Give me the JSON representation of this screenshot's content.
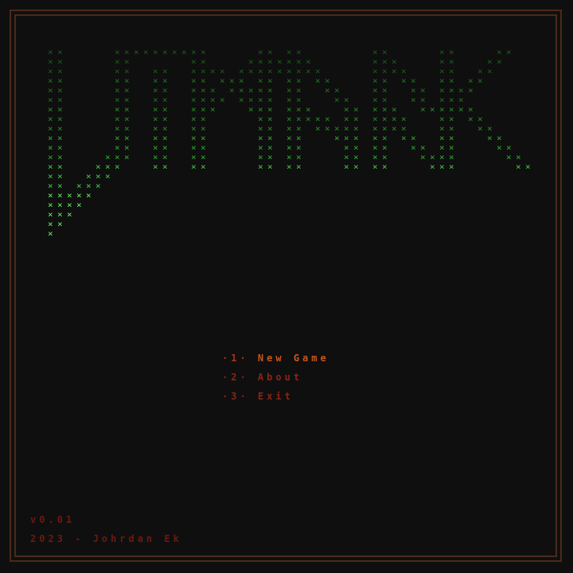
{
  "title_art": {
    "glyph": "×",
    "colors": [
      "#1f5a1f",
      "#237223",
      "#2a8a2a",
      "#34a834",
      "#44cc44",
      "#66ee66"
    ]
  },
  "menu": {
    "items": [
      {
        "key": "·1·",
        "label": "New Game",
        "active": true
      },
      {
        "key": "·2·",
        "label": "About",
        "active": false
      },
      {
        "key": "·3·",
        "label": "Exit",
        "active": false
      }
    ]
  },
  "footer": {
    "version": "v0.01",
    "credit": "2023 - Johrdan Ek"
  },
  "colors": {
    "background": "#0f0f0f",
    "border": "#4a2a1a",
    "menu_active": "#c8561a",
    "menu_inactive": "#8a2418",
    "footer": "#6e1810"
  }
}
